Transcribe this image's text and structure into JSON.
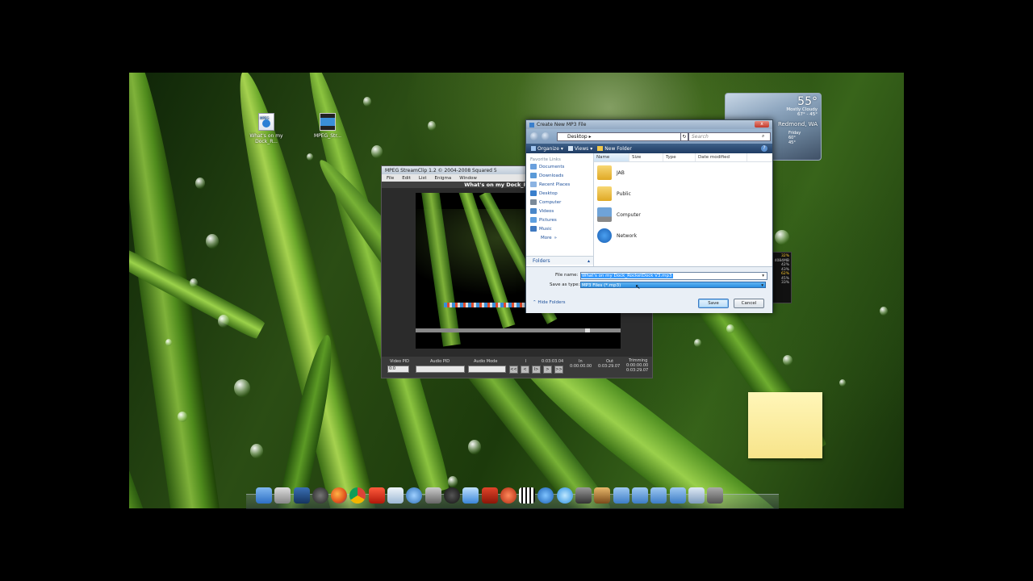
{
  "desktop": {
    "icons": [
      {
        "label": "What's on my Dock_R...",
        "badge": "MPEG"
      },
      {
        "label": "MPEG_Str..."
      }
    ]
  },
  "player": {
    "title": "MPEG StreamClip 1.2 © 2004-2008 Squared 5",
    "menu": [
      "File",
      "Edit",
      "List",
      "Enigma",
      "Window"
    ],
    "video_title": "What's on my Dock_Ro",
    "labels": {
      "video_pid": "Video PID",
      "audio_pid": "Audio PID",
      "audio_mode": "Audio Mode",
      "in": "In",
      "out": "Out",
      "trimming": "Trimming"
    },
    "video_pid_value": "0:0",
    "marker": "I",
    "timecodes": {
      "current": "0:03:03.04",
      "in": "0:00:00.00",
      "out": "0:03:29.07",
      "trim_in": "0:00:00.00",
      "trim_out": "0:03:29.07"
    },
    "transport": [
      "<<",
      "<",
      "I>",
      ">",
      ">>"
    ]
  },
  "dialog": {
    "title": "Create New MP3 File",
    "close": "x",
    "location": "Desktop",
    "search_placeholder": "Search",
    "toolbar": {
      "organize": "Organize",
      "views": "Views",
      "new_folder": "New Folder",
      "help": "?"
    },
    "favorites_heading": "Favorite Links",
    "favorites": [
      "Documents",
      "Downloads",
      "Recent Places",
      "Desktop",
      "Computer",
      "Videos",
      "Pictures",
      "Music"
    ],
    "more": "More",
    "folders_label": "Folders",
    "columns": [
      "Name",
      "Size",
      "Type",
      "Date modified"
    ],
    "files": [
      "JAB",
      "Public",
      "Computer",
      "Network"
    ],
    "file_name_label": "File name:",
    "file_name_value": "What's on my Dock_RocketDock V3.mp3",
    "save_type_label": "Save as type:",
    "save_type_value": "MP3 Files (*.mp3)",
    "hide_folders": "Hide Folders",
    "save_button": "Save",
    "cancel_button": "Cancel"
  },
  "weather": {
    "temp": "55°",
    "condition": "Mostly Cloudy",
    "range": "67° - 45°",
    "city": "Redmond, WA",
    "forecast_day": "Friday",
    "forecast_hi": "60°",
    "forecast_lo": "45°"
  },
  "cpu_meter": {
    "top": "32%",
    "label": "4084MB",
    "rows": [
      "42%",
      "43%",
      "62%",
      "45%",
      "33%"
    ]
  },
  "colors": {
    "accent": "#3399ff",
    "dialog_toolbar": "#2a4a75",
    "note": "#fbef9e"
  }
}
